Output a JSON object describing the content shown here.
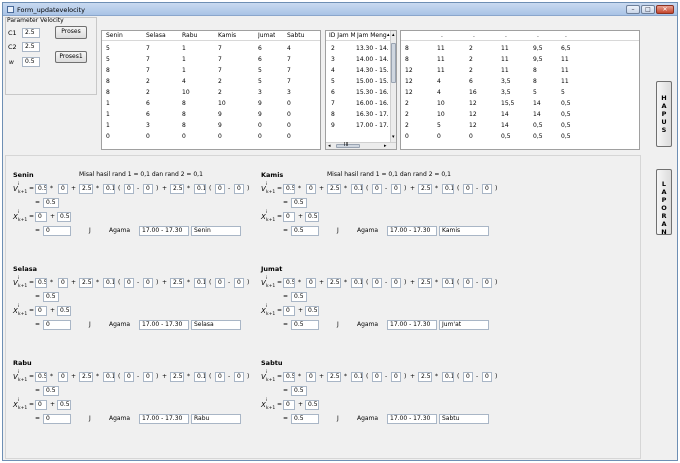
{
  "window": {
    "title": "Form_updatevelocity",
    "min": "–",
    "max": "□",
    "close": "✕"
  },
  "params": {
    "group_label": "Parameter Velocity",
    "c1_label": "C1",
    "c1_value": "2.5",
    "c2_label": "C2",
    "c2_value": "2.5",
    "w_label": "w",
    "w_value": "0.5",
    "proses_btn": "Proses",
    "proses1_btn": "Proses1"
  },
  "days_table": {
    "headers": [
      "Senin",
      "Selasa",
      "Rabu",
      "Kamis",
      "Jumat",
      "Sabtu"
    ],
    "rows": [
      [
        "5",
        "7",
        "1",
        "7",
        "6",
        "4"
      ],
      [
        "5",
        "7",
        "1",
        "7",
        "6",
        "7"
      ],
      [
        "8",
        "7",
        "1",
        "7",
        "5",
        "7"
      ],
      [
        "8",
        "2",
        "4",
        "2",
        "5",
        "7"
      ],
      [
        "8",
        "2",
        "10",
        "2",
        "3",
        "3"
      ],
      [
        "1",
        "6",
        "8",
        "10",
        "9",
        "0"
      ],
      [
        "1",
        "6",
        "8",
        "9",
        "9",
        "0"
      ],
      [
        "1",
        "3",
        "8",
        "9",
        "0",
        "0"
      ],
      [
        "0",
        "0",
        "0",
        "0",
        "0",
        "0"
      ]
    ]
  },
  "jam_table": {
    "headers": [
      "ID Jam M...",
      "Jam Mengaj"
    ],
    "rows": [
      [
        "2",
        "13.30 - 14."
      ],
      [
        "3",
        "14.00 - 14."
      ],
      [
        "4",
        "14.30 - 15."
      ],
      [
        "5",
        "15.00 - 15."
      ],
      [
        "6",
        "15.30 - 16."
      ],
      [
        "7",
        "16.00 - 16."
      ],
      [
        "8",
        "16.30 - 17."
      ],
      [
        "9",
        "17.00 - 17."
      ]
    ],
    "hscroll_label": "III"
  },
  "right_table": {
    "headers": [
      "",
      ".",
      ".",
      ".",
      ".",
      "."
    ],
    "rows": [
      [
        "8",
        "11",
        "2",
        "11",
        "9,5",
        "6,5"
      ],
      [
        "8",
        "11",
        "2",
        "11",
        "9,5",
        "11"
      ],
      [
        "12",
        "11",
        "2",
        "11",
        "8",
        "11"
      ],
      [
        "12",
        "4",
        "6",
        "3,5",
        "8",
        "11"
      ],
      [
        "12",
        "4",
        "16",
        "3,5",
        "5",
        "5"
      ],
      [
        "2",
        "10",
        "12",
        "15,5",
        "14",
        "0,5"
      ],
      [
        "2",
        "10",
        "12",
        "14",
        "14",
        "0,5"
      ],
      [
        "2",
        "5",
        "12",
        "14",
        "0,5",
        "0,5"
      ],
      [
        "0",
        "0",
        "0",
        "0,5",
        "0,5",
        "0,5"
      ]
    ]
  },
  "side_buttons": {
    "hapus": [
      "H",
      "A",
      "P",
      "U",
      "S"
    ],
    "laporan": [
      "L",
      "A",
      "P",
      "O",
      "R",
      "A",
      "N"
    ]
  },
  "formula": {
    "note": "Misal hasil rand 1 = 0,1 dan rand 2 = 0,1",
    "v_sym": "V",
    "x_sym": "X",
    "sup": "i",
    "sub": "k+1",
    "eq": "=",
    "times": "*",
    "plus": "+",
    "minus": "-",
    "lp": "(",
    "rp": ")",
    "w": "0.5",
    "v0": "0",
    "c": "2.5",
    "r": "0.1",
    "p": "0",
    "q": "0",
    "res": "0.5",
    "j": "J",
    "agama": "Agama",
    "jam": "17.00 - 17.30"
  },
  "days": [
    {
      "name": "Senin",
      "show_note": true,
      "xval": "0",
      "xres": "0",
      "day_box": "Senin"
    },
    {
      "name": "Selasa",
      "show_note": false,
      "xval": "0",
      "xres": "0",
      "day_box": "Selasa"
    },
    {
      "name": "Rabu",
      "show_note": false,
      "xval": "0",
      "xres": "0",
      "day_box": "Rabu"
    },
    {
      "name": "Kamis",
      "show_note": true,
      "xval": "0",
      "xres": "0.5",
      "day_box": "Kamis"
    },
    {
      "name": "Jumat",
      "show_note": false,
      "xval": "0",
      "xres": "0.5",
      "day_box": "Jum'at"
    },
    {
      "name": "Sabtu",
      "show_note": false,
      "xval": "0",
      "xres": "0.5",
      "day_box": "Sabtu"
    }
  ]
}
